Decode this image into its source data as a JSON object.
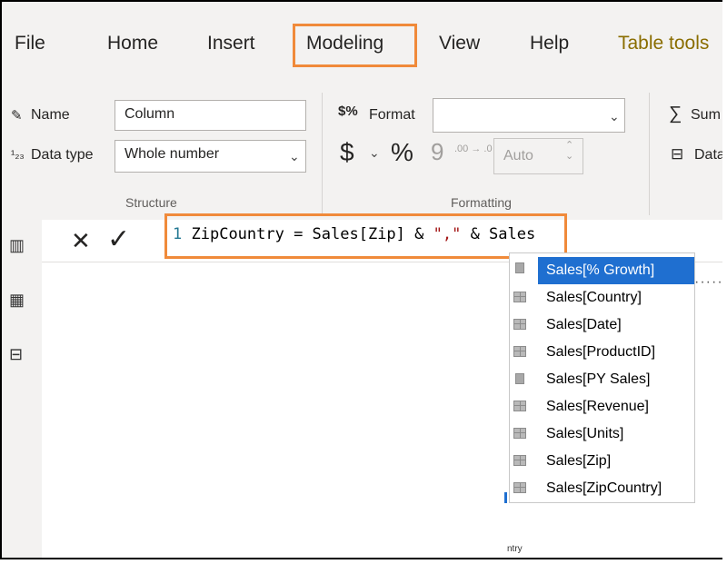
{
  "tabs": [
    "File",
    "Home",
    "Insert",
    "Modeling",
    "View",
    "Help",
    "Table tools"
  ],
  "ribbon": {
    "name_label": "Name",
    "name_value": "Column",
    "datatype_label": "Data type",
    "datatype_value": "Whole number",
    "structure_label": "Structure",
    "format_label": "Format",
    "format_value": "",
    "format_symbol": "$%",
    "currency_symbol": "$",
    "percent_symbol": "%",
    "comma_symbol": "9",
    "decimal_symbol": ".00 → .0",
    "auto_value": "Auto",
    "formatting_label": "Formatting",
    "summarization_label": "Sum",
    "data_category_label": "Data"
  },
  "formula": {
    "line_number": "1",
    "prefix": "ZipCountry = Sales[Zip] & ",
    "string_literal": "\",\"",
    "suffix": " & Sales"
  },
  "autocomplete": [
    {
      "label": "Sales[% Growth]",
      "icon": "calculator-icon",
      "selected": true
    },
    {
      "label": "Sales[Country]",
      "icon": "table-column-icon",
      "selected": false
    },
    {
      "label": "Sales[Date]",
      "icon": "table-column-icon",
      "selected": false
    },
    {
      "label": "Sales[ProductID]",
      "icon": "table-column-icon",
      "selected": false
    },
    {
      "label": "Sales[PY Sales]",
      "icon": "calculator-icon",
      "selected": false
    },
    {
      "label": "Sales[Revenue]",
      "icon": "table-column-icon",
      "selected": false
    },
    {
      "label": "Sales[Units]",
      "icon": "table-column-icon",
      "selected": false
    },
    {
      "label": "Sales[Zip]",
      "icon": "table-column-icon",
      "selected": false
    },
    {
      "label": "Sales[ZipCountry]",
      "icon": "table-column-icon",
      "selected": false
    }
  ],
  "caption": "ntry",
  "colors": {
    "highlight": "#f08a3a",
    "selection": "#1f6fd0",
    "tabletools": "#8a6d00"
  }
}
